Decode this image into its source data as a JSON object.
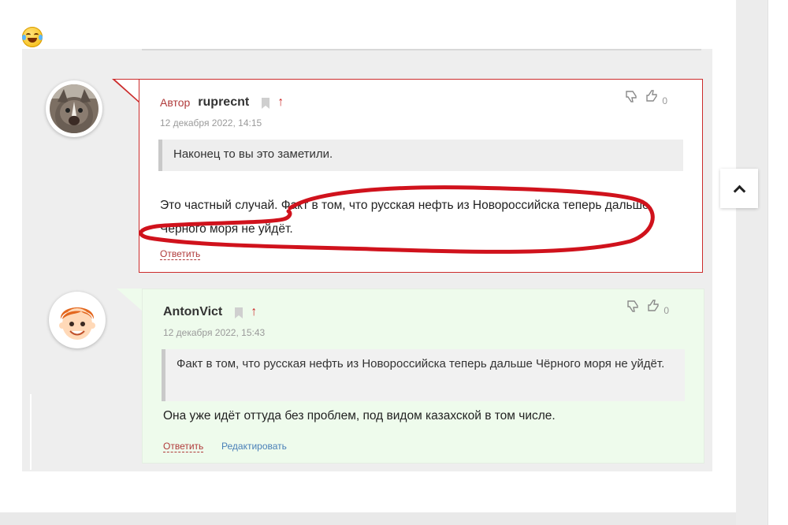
{
  "comments": [
    {
      "author_tag": "Автор",
      "username": "ruprecnt",
      "up_arrow": "↑",
      "date": "12 декабря 2022, 14:15",
      "quote": "Наконец то вы это заметили.",
      "text_before": "Это частный случай.",
      "text_highlight": "Факт в том, что русская нефть из Новороссийска теперь дальше Чёрного моря не уйдёт.",
      "vote_count": "0",
      "reply_label": "Ответить"
    },
    {
      "username": "AntonVict",
      "up_arrow": "↑",
      "date": "12 декабря 2022, 15:43",
      "quote": "Факт в том, что русская нефть из Новороссийска теперь дальше Чёрного моря не уйдёт.",
      "text": "Она уже идёт оттуда без проблем, под видом казахской в том числе.",
      "vote_count": "0",
      "reply_label": "Ответить",
      "edit_label": "Редактировать"
    }
  ],
  "icons": {
    "emoji": "laughing-with-tears-emoji-icon",
    "dislike": "thumbs-down-icon",
    "like": "thumbs-up-icon",
    "bookmark": "bookmark-icon",
    "scroll_top": "chevron-up-icon"
  },
  "colors": {
    "highlight_border": "#cc2b2b",
    "reply_link": "#b03a3a",
    "edit_link": "#4a80b8",
    "comment2_bg": "#eefbec"
  }
}
